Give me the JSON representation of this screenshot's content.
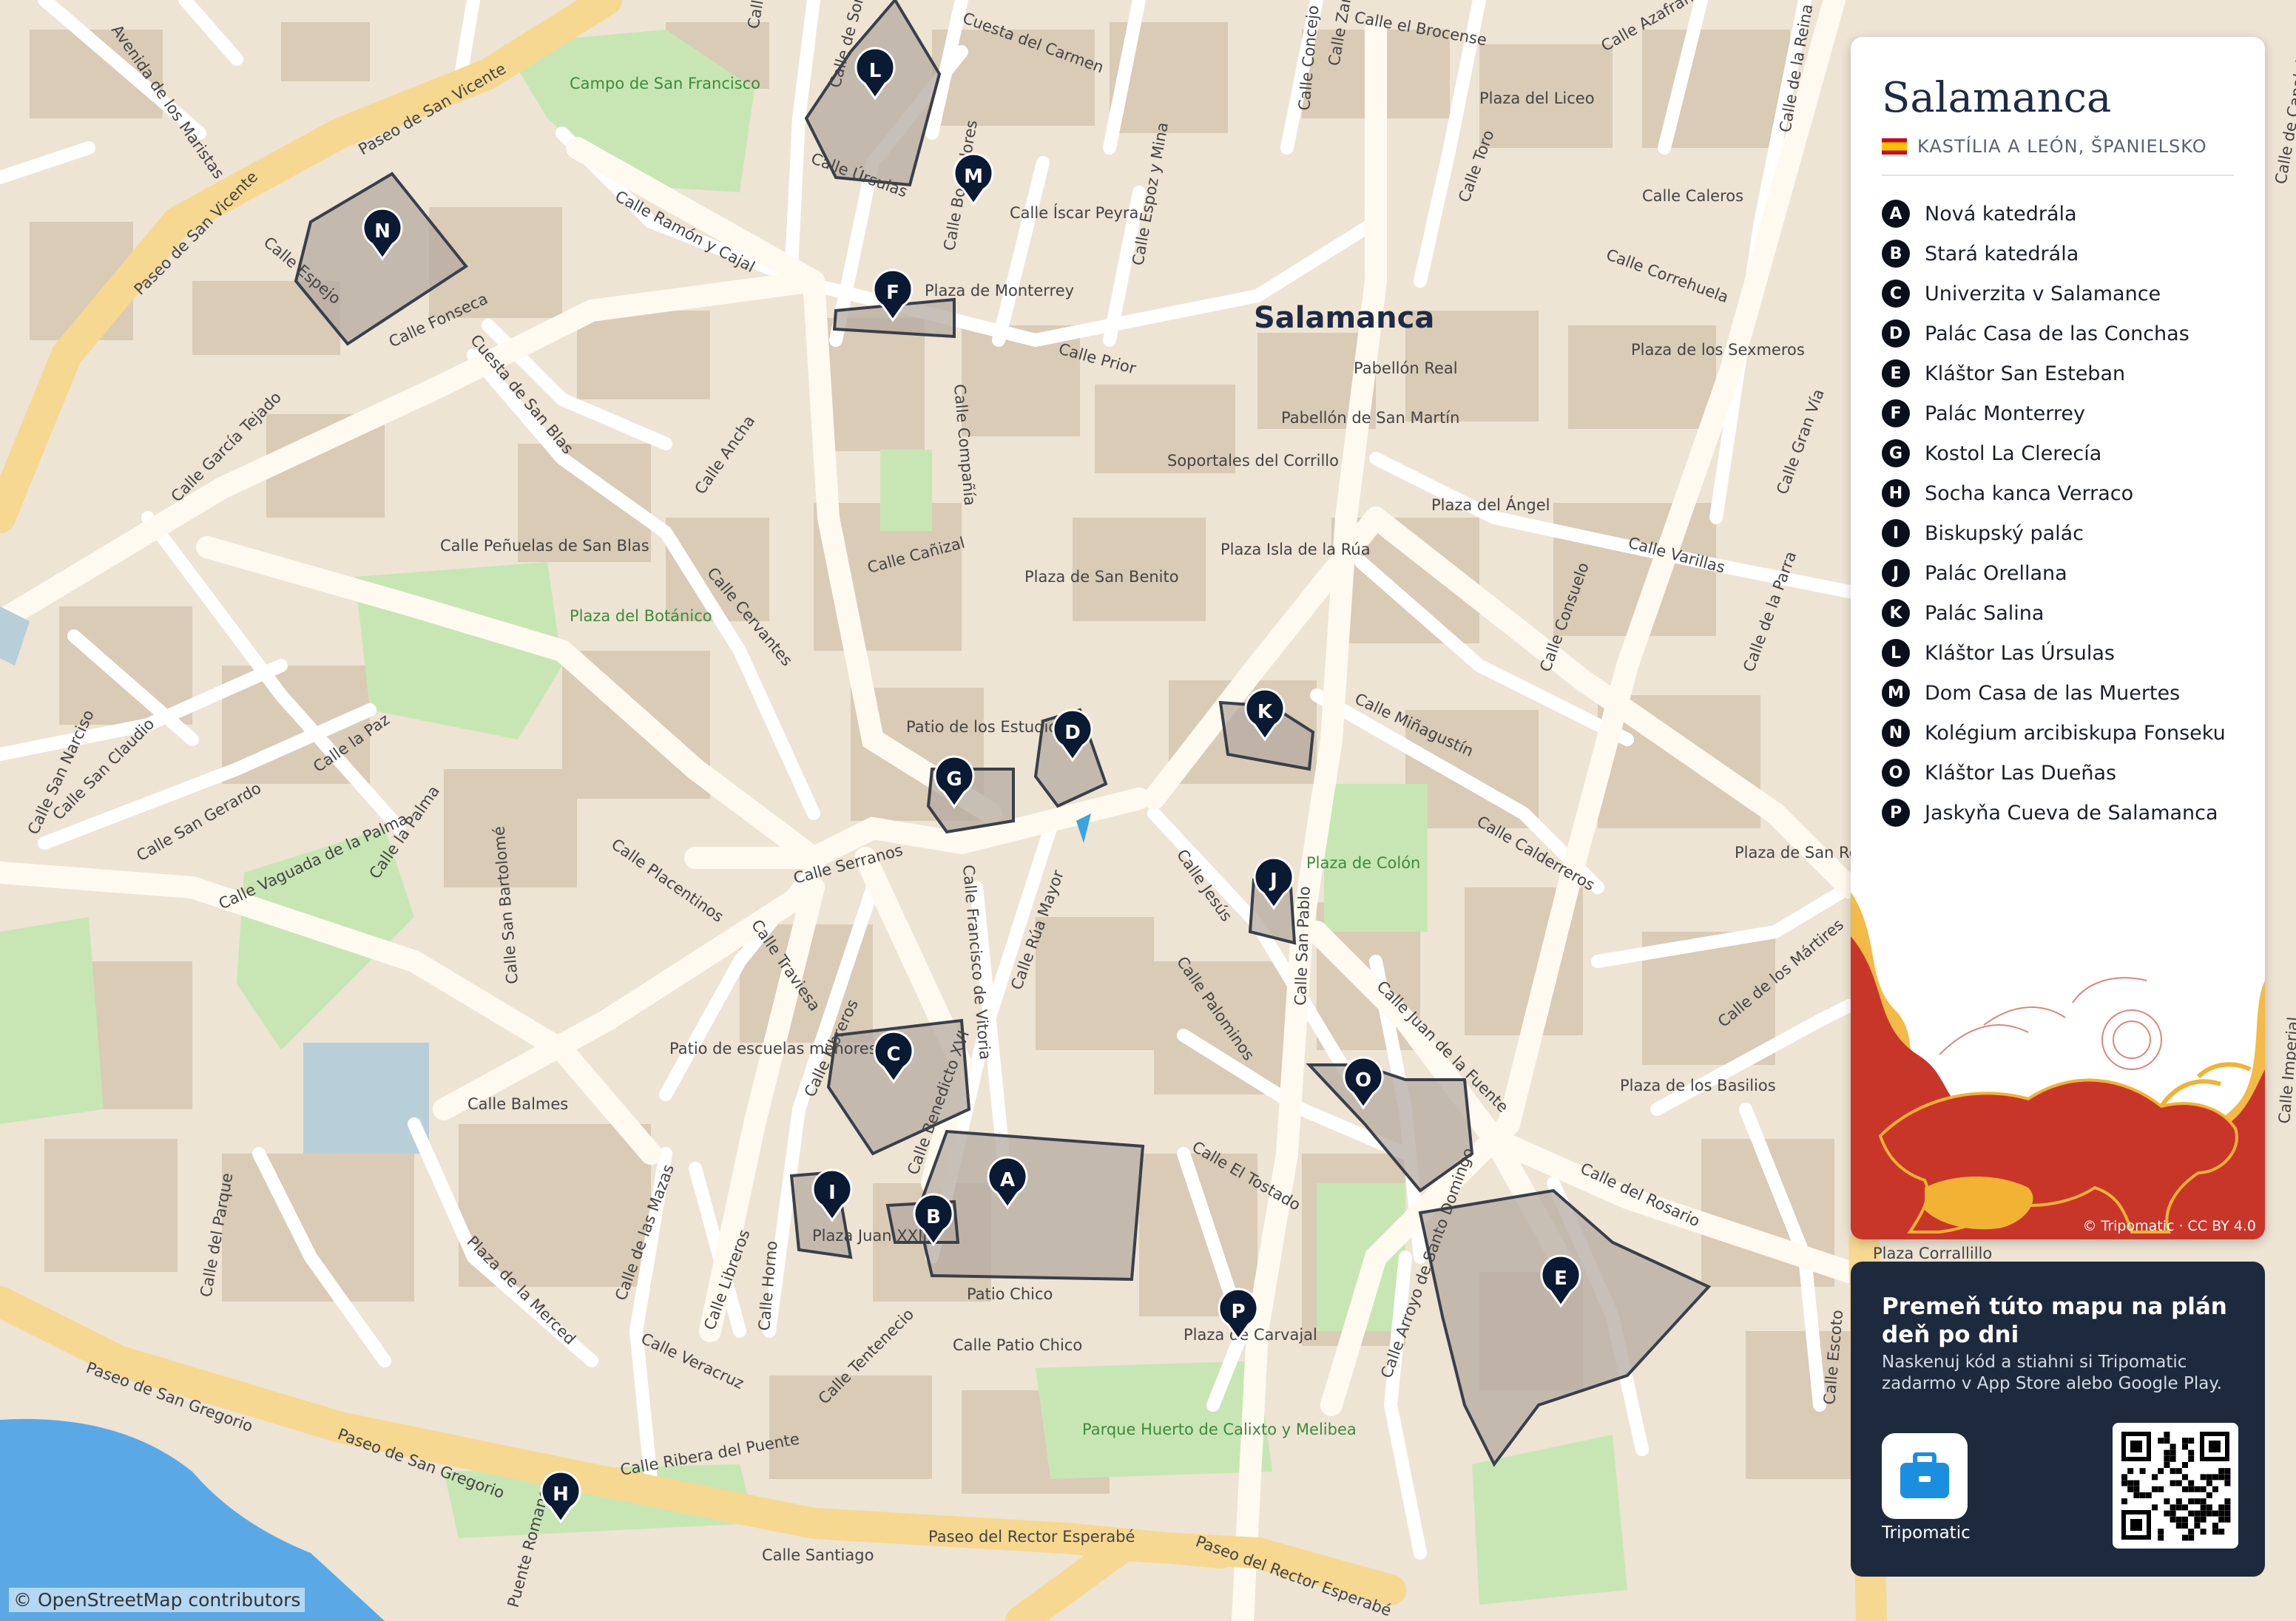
{
  "map": {
    "city_label": "Salamanca",
    "streets": [
      "Calle Abajo",
      "Calle de Sorias",
      "Cuesta del Carmen",
      "Calle Concejo",
      "Calle Zamora",
      "Calle el Brocense",
      "Calle Azafranal",
      "Calle de la Reina",
      "Avenida de los Maristas",
      "Paseo de San Vicente",
      "Paseo de San Vicente",
      "Calle Espejo",
      "Calle Fonseca",
      "Calle Ramón y Cajal",
      "Calle Úrsulas",
      "Calle Bordadores",
      "Calle Íscar Peyra",
      "Calle Espoz y Mina",
      "Plaza del Liceo",
      "Calle Toro",
      "Calle Caleros",
      "Calle Correhuela",
      "Calle Gran Vía",
      "Plaza de Monterrey",
      "Calle Prior",
      "Pabellón Real",
      "Plaza de los Sexmeros",
      "Calle Compañía",
      "Pabellón de San Martín",
      "Cuesta de San Blas",
      "Calle García Tejado",
      "Calle Ancha",
      "Soportales del Corrillo",
      "Plaza del Ángel",
      "Calle Varillas",
      "Calle Peñuelas de San Blas",
      "Calle Cañizal",
      "Plaza Isla de la Rúa",
      "Calle Consuelo",
      "Calle de la Parra",
      "Plaza de San Benito",
      "Calle Cervantes",
      "Calle Miñagustín",
      "Patio de los Estudios",
      "Calle San Narciso",
      "Calle San Claudio",
      "Calle San Gerardo",
      "Calle la Paz",
      "Calle Vaguada de la Palma",
      "Calle la Palma",
      "Calle Placentinos",
      "Calle Serranos",
      "Calle San Bartolomé",
      "Calle Jesús",
      "Calle Calderreros",
      "Plaza de San Román",
      "Calle Traviesa",
      "Calle Francisco de Vitoria",
      "Calle Rúa Mayor",
      "Calle Palominos",
      "Calle Juan de la Fuente",
      "Calle de los Mártires",
      "Patio de escuelas menores",
      "Calle Libreros",
      "Calle Benedicto XVI",
      "Calle Balmes",
      "Calle San Pablo",
      "Plaza de los Basilios",
      "Calle El Tostado",
      "Calle del Rosario",
      "Plaza Juan XXIII",
      "Calle de las Mazas",
      "Calle del Parque",
      "Plaza de la Merced",
      "Calle Libreros",
      "Calle Horno",
      "Patio Chico",
      "Calle Arroyo de Santo Domingo",
      "Plaza Corrallillo",
      "Calle Escoto",
      "Calle Veracruz",
      "Calle Tentenecio",
      "Calle Patio Chico",
      "Plaza de Carvajal",
      "Paseo de San Gregorio",
      "Paseo de San Gregorio",
      "Calle Ribera del Puente",
      "Puente Romano",
      "Calle Santiago",
      "Paseo del Rector Esperabé",
      "Paseo del Rector Esperabé",
      "Calle Imperial",
      "Calle de Canalejas"
    ],
    "green_places": [
      "Campo de San Francisco",
      "Plaza del Botánico",
      "Plaza de Colón",
      "Parque Huerto de Calixto y Melibea"
    ],
    "osm_credit": "© OpenStreetMap contributors"
  },
  "markers": [
    {
      "letter": "A"
    },
    {
      "letter": "B"
    },
    {
      "letter": "C"
    },
    {
      "letter": "D"
    },
    {
      "letter": "E"
    },
    {
      "letter": "F"
    },
    {
      "letter": "G"
    },
    {
      "letter": "H"
    },
    {
      "letter": "I"
    },
    {
      "letter": "J"
    },
    {
      "letter": "K"
    },
    {
      "letter": "L"
    },
    {
      "letter": "M"
    },
    {
      "letter": "N"
    },
    {
      "letter": "O"
    },
    {
      "letter": "P"
    }
  ],
  "panel": {
    "city": "Salamanca",
    "region": "KASTÍLIA A LEÓN, ŠPANIELSKO",
    "flag_icon": "spain-flag-icon",
    "pois": [
      {
        "letter": "A",
        "name": "Nová katedrála"
      },
      {
        "letter": "B",
        "name": "Stará katedrála"
      },
      {
        "letter": "C",
        "name": "Univerzita v Salamance"
      },
      {
        "letter": "D",
        "name": "Palác Casa de las Conchas"
      },
      {
        "letter": "E",
        "name": "Kláštor San Esteban"
      },
      {
        "letter": "F",
        "name": "Palác Monterrey"
      },
      {
        "letter": "G",
        "name": "Kostol La Clerecía"
      },
      {
        "letter": "H",
        "name": "Socha kanca Verraco"
      },
      {
        "letter": "I",
        "name": "Biskupský palác"
      },
      {
        "letter": "J",
        "name": "Palác Orellana"
      },
      {
        "letter": "K",
        "name": "Palác Salina"
      },
      {
        "letter": "L",
        "name": "Kláštor Las Úrsulas"
      },
      {
        "letter": "M",
        "name": "Dom Casa de las Muertes"
      },
      {
        "letter": "N",
        "name": "Kolégium arcibiskupa Fonseku"
      },
      {
        "letter": "O",
        "name": "Kláštor Las Dueñas"
      },
      {
        "letter": "P",
        "name": "Jaskyňa Cueva de Salamanca"
      }
    ],
    "art_credit": "© Tripomatic · CC BY 4.0"
  },
  "promo": {
    "title": "Premeň túto mapu na plán deň po dni",
    "text": "Naskenuj kód a stiahni si Tripomatic zadarmo v App Store alebo Google Play.",
    "app_label": "Tripomatic",
    "app_icon": "suitcase-icon",
    "qr_icon": "qr-code-icon"
  },
  "colors": {
    "map_bg": "#ede4d4",
    "building": "#d9cbb6",
    "park": "#c8e6b4",
    "road_major": "#f6d891",
    "water": "#5aa9e6",
    "marker": "#0b1a33",
    "poi_outline": "#3a3f48",
    "art_red": "#c8362a",
    "art_yellow": "#f2b233",
    "promo_bg": "#1d2a3e",
    "app_blue": "#1a8fe0"
  }
}
